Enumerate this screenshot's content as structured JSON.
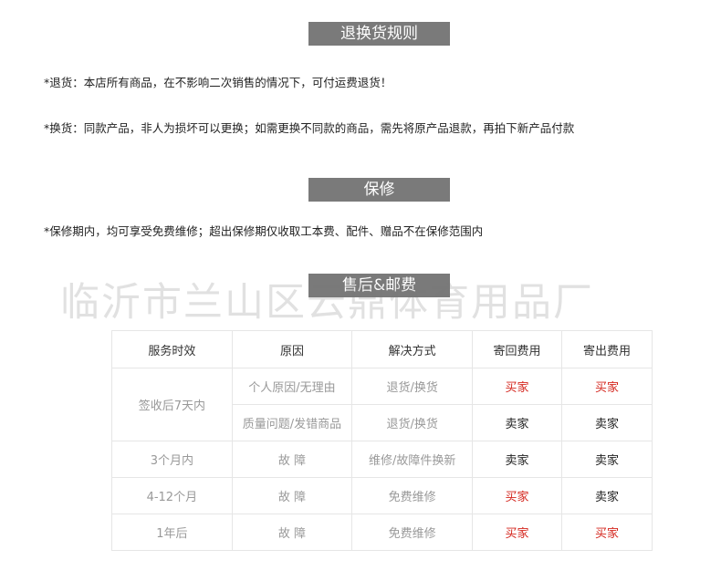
{
  "sections": {
    "return_rules": {
      "title": "退换货规则"
    },
    "warranty": {
      "title": "保修"
    },
    "after_sales": {
      "title": "售后&邮费"
    }
  },
  "rules": {
    "return": "*退货：本店所有商品，在不影响二次销售的情况下，可付运费退货！",
    "exchange": "*换货：同款产品，非人为损坏可以更换；如需更换不同款的商品，需先将原产品退款，再拍下新产品付款",
    "warranty": "*保修期内，均可享受免费维修；超出保修期仅收取工本费、配件、赠品不在保修范围内"
  },
  "watermark": "临沂市兰山区云鼎体育用品厂",
  "table": {
    "headers": [
      "服务时效",
      "原因",
      "解决方式",
      "寄回费用",
      "寄出费用"
    ],
    "rows": [
      {
        "period": "签收后7天内",
        "reason": "个人原因/无理由",
        "solution": "退货/换货",
        "return_fee": "买家",
        "send_fee": "买家"
      },
      {
        "reason": "质量问题/发错商品",
        "solution": "退货/换货",
        "return_fee": "卖家",
        "send_fee": "卖家"
      },
      {
        "period": "3个月内",
        "reason": "故 障",
        "solution": "维修/故障件换新",
        "return_fee": "卖家",
        "send_fee": "卖家"
      },
      {
        "period": "4-12个月",
        "reason": "故 障",
        "solution": "免费维修",
        "return_fee": "买家",
        "send_fee": "卖家"
      },
      {
        "period": "1年后",
        "reason": "故 障",
        "solution": "免费维修",
        "return_fee": "买家",
        "send_fee": "买家"
      }
    ]
  },
  "colors": {
    "banner_bg": "#7a7a7a",
    "buyer_red": "#d4261e",
    "seller_black": "#222222",
    "muted_gray": "#999999"
  }
}
